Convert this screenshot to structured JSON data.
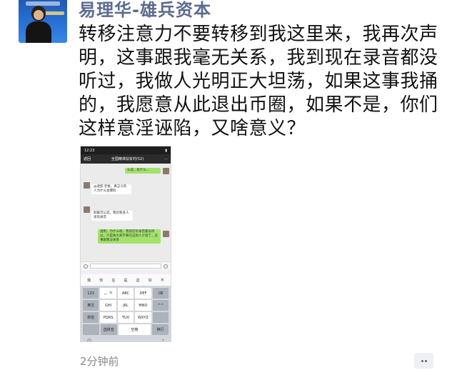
{
  "post": {
    "author": "易理华-雄兵资本",
    "text": "转移注意力不要转移到我这里来，我再次声明，这事跟我毫无关系，我到现在录音都没听过，我做人光明正大坦荡，如果这事我捅的，我愿意从此退出币圈，如果不是，你们这样意淫诬陷，又啥意义？",
    "time": "2分钟前"
  },
  "screenshot": {
    "status_time": "12:23",
    "back_label": "返回",
    "group_title": "全国精准扶贫村(52)",
    "messages": [
      {
        "side": "right",
        "text": "么说...有什么..."
      },
      {
        "side": "left",
        "text": "@透底 老板，真正义的人为什么会爆料"
      },
      {
        "side": "left",
        "text": "别耽可以说，我也和多人发现录音"
      },
      {
        "side": "right",
        "text": "透明，为什么呢，我现在听录音都没听过，只是防大家不要在这别人计划了，这事跟我没关系"
      }
    ],
    "suggestions": [
      "我",
      "你",
      "在",
      "是",
      "这",
      "好",
      "不"
    ],
    "keys": [
      [
        "123",
        "，。?!",
        "ABC",
        "DEF",
        "⌫"
      ],
      [
        "英文",
        "GHI",
        "JKL",
        "MNO",
        "^^"
      ],
      [
        "拼音",
        "PQRS",
        "TUV",
        "WXYZ",
        ""
      ],
      [
        "",
        "选拼音",
        "空格",
        "",
        "换行"
      ]
    ]
  },
  "colors": {
    "author": "#5b6b8f",
    "bubble_mine": "#a3e36c",
    "meta": "#8a8a8a"
  }
}
